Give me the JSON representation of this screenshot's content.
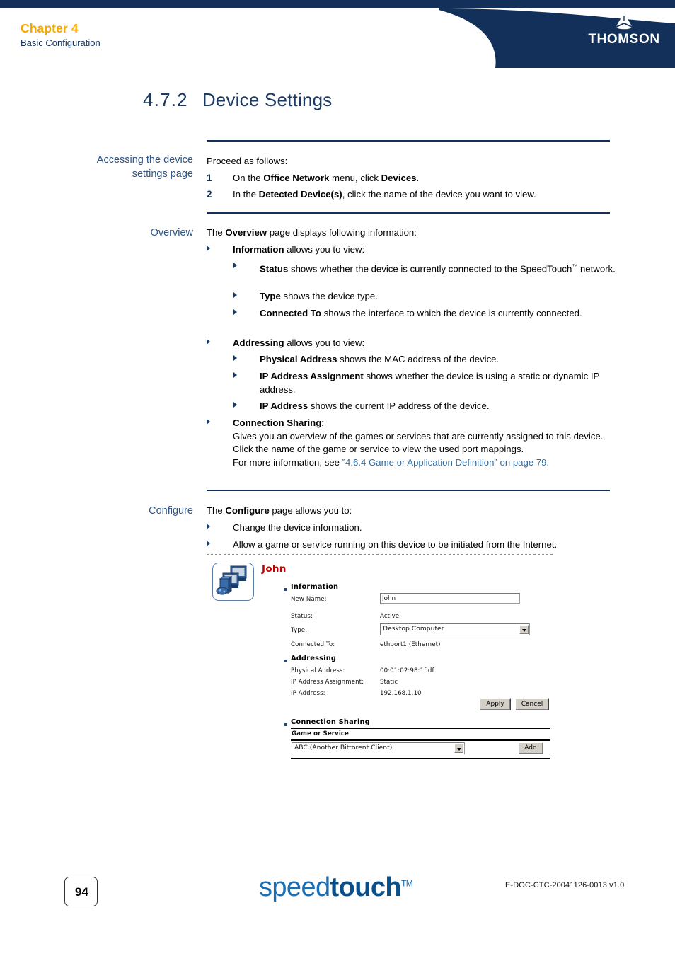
{
  "header": {
    "chapter": "Chapter 4",
    "subtitle": "Basic Configuration",
    "brand": "THOMSON"
  },
  "section": {
    "number": "4.7.2",
    "title": "Device Settings"
  },
  "accessing": {
    "side_label_line1": "Accessing the device",
    "side_label_line2": "settings page",
    "intro": "Proceed as follows:",
    "steps": [
      {
        "n": "1",
        "html": "On the <b>Office Network</b> menu, click <b>Devices</b>."
      },
      {
        "n": "2",
        "html": "In the <b>Detected Device(s)</b>, click the name of the device you want to view."
      }
    ]
  },
  "overview": {
    "side_label": "Overview",
    "intro": "The <b>Overview</b> page displays following information:",
    "items": [
      {
        "level": 1,
        "html": "<b>Information</b> allows you to view:"
      },
      {
        "level": 2,
        "html": "<b>Status</b> shows whether the device is currently connected to the SpeedTouch<span class=\"sup\">&#8482;</span> network."
      },
      {
        "level": 2,
        "html": "<b>Type</b> shows the device type."
      },
      {
        "level": 2,
        "html": "<b>Connected To</b> shows the interface to which the device is currently connected."
      },
      {
        "level": 1,
        "html": "<b>Addressing</b> allows you to view:"
      },
      {
        "level": 2,
        "html": "<b>Physical Address</b> shows the MAC address of the device."
      },
      {
        "level": 2,
        "html": "<b>IP Address Assignment</b> shows whether the device is using a static or dynamic IP address."
      },
      {
        "level": 2,
        "html": "<b>IP Address</b> shows the current IP address of the device."
      },
      {
        "level": 1,
        "html": "<b>Connection Sharing</b>:<br>Gives you an overview of the games or services that are currently assigned to this device. Click the name of the game or service to view the used port mappings.<br>For more information, see <span class=\"xlink\">&#8221;4.6.4 Game or Application Definition&#8221; on page 79</span>."
      }
    ]
  },
  "configure": {
    "side_label": "Configure",
    "intro": "The <b>Configure</b> page allows you to:",
    "items": [
      {
        "html": "Change the device information."
      },
      {
        "html": "Allow a game or service running on this device to be initiated from the Internet."
      }
    ]
  },
  "screenshot": {
    "device_name": "John",
    "device_icon": "desktop-computer-icon",
    "sections": {
      "information": {
        "heading": "Information",
        "new_name_label": "New Name:",
        "new_name_value": "John",
        "status_label": "Status:",
        "status_value": "Active",
        "type_label": "Type:",
        "type_value": "Desktop Computer",
        "connected_to_label": "Connected To:",
        "connected_to_value": "ethport1 (Ethernet)"
      },
      "addressing": {
        "heading": "Addressing",
        "physical_address_label": "Physical Address:",
        "physical_address_value": "00:01:02:98:1f:df",
        "ip_assignment_label": "IP Address Assignment:",
        "ip_assignment_value": "Static",
        "ip_address_label": "IP Address:",
        "ip_address_value": "192.168.1.10"
      },
      "buttons": {
        "apply": "Apply",
        "cancel": "Cancel"
      },
      "connection_sharing": {
        "heading": "Connection Sharing",
        "column_header": "Game or Service",
        "selected_service": "ABC (Another Bittorent Client)",
        "add_button": "Add"
      }
    }
  },
  "footer": {
    "page_number": "94",
    "product_light": "speed",
    "product_bold": "touch",
    "product_tm": "TM",
    "doc_code": "E-DOC-CTC-20041126-0013 v1.0"
  },
  "colors": {
    "navy": "#12305A",
    "amber": "#F5A800",
    "link": "#2E6DA4",
    "red": "#C00000"
  }
}
